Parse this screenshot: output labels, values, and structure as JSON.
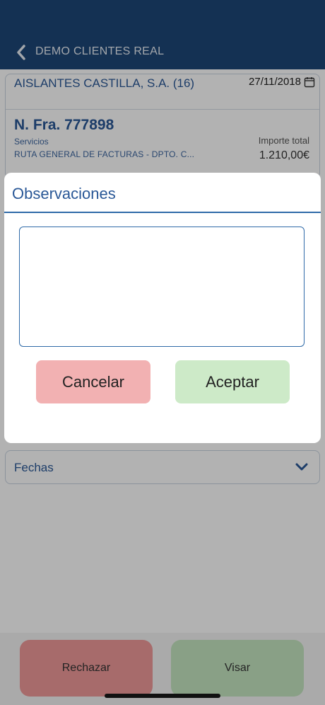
{
  "header": {
    "title": "DEMO CLIENTES REAL"
  },
  "card": {
    "client": "AISLANTES CASTILLA, S.A. (16)",
    "date": "27/11/2018",
    "invoice_number": "N. Fra. 777898",
    "type": "Servicios",
    "route": "RUTA GENERAL DE FACTURAS - DPTO. C...",
    "total_label": "Importe total",
    "total_value": "1.210,00€"
  },
  "fechas": {
    "label": "Fechas"
  },
  "actions": {
    "reject_label": "Rechazar",
    "approve_label": "Visar"
  },
  "modal": {
    "title": "Observaciones",
    "text_value": "",
    "cancel_label": "Cancelar",
    "accept_label": "Aceptar"
  },
  "colors": {
    "header_bg": "#1e4778",
    "accent": "#2a5897",
    "reject": "#ef9a9a",
    "approve": "#c5e6c1"
  }
}
